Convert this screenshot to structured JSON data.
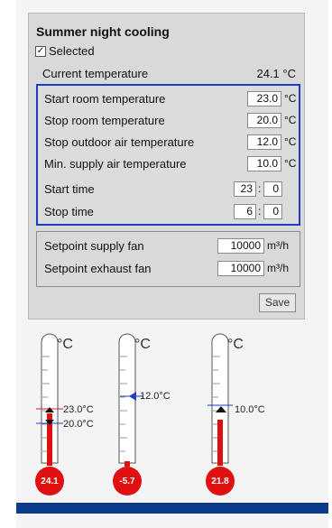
{
  "section": {
    "title": "Summer night cooling",
    "selected_label": "Selected",
    "selected_checked": true,
    "current_temperature_label": "Current temperature",
    "current_temperature_value": "24.1 °C"
  },
  "parameters": {
    "start_room_temp": {
      "label": "Start room temperature",
      "value": "23.0",
      "unit": "°C"
    },
    "stop_room_temp": {
      "label": "Stop room temperature",
      "value": "20.0",
      "unit": "°C"
    },
    "stop_outdoor_temp": {
      "label": "Stop outdoor air temperature",
      "value": "12.0",
      "unit": "°C"
    },
    "min_supply_temp": {
      "label": "Min. supply air temperature",
      "value": "10.0",
      "unit": "°C"
    },
    "start_time": {
      "label": "Start time",
      "hour": "23",
      "separator": ":",
      "minute": "0"
    },
    "stop_time": {
      "label": "Stop time",
      "hour": "6",
      "separator": ":",
      "minute": "0"
    }
  },
  "fans": {
    "supply": {
      "label": "Setpoint supply fan",
      "value": "10000",
      "unit": "m³/h"
    },
    "exhaust": {
      "label": "Setpoint exhaust fan",
      "value": "10000",
      "unit": "m³/h"
    }
  },
  "save_label": "Save",
  "thermometers": [
    {
      "unit_label": "°C",
      "bulb_value": "24.1",
      "markers": [
        {
          "label": "23.0°C",
          "color": "#d42020",
          "arrow": "up"
        },
        {
          "label": "20.0°C",
          "color": "#1f3cc6",
          "arrow": "down"
        }
      ]
    },
    {
      "unit_label": "°C",
      "bulb_value": "-5.7",
      "markers": [
        {
          "label": "12.0°C",
          "color": "#1f3cc6",
          "arrow": "left"
        }
      ]
    },
    {
      "unit_label": "°C",
      "bulb_value": "21.8",
      "markers": [
        {
          "label": "10.0°C",
          "color": "#1f3cc6",
          "arrow": "up"
        }
      ]
    }
  ],
  "colors": {
    "accent_blue": "#1f3cc6",
    "thermometer_red": "#e01010",
    "bottom_bar": "#0e3c8c"
  }
}
